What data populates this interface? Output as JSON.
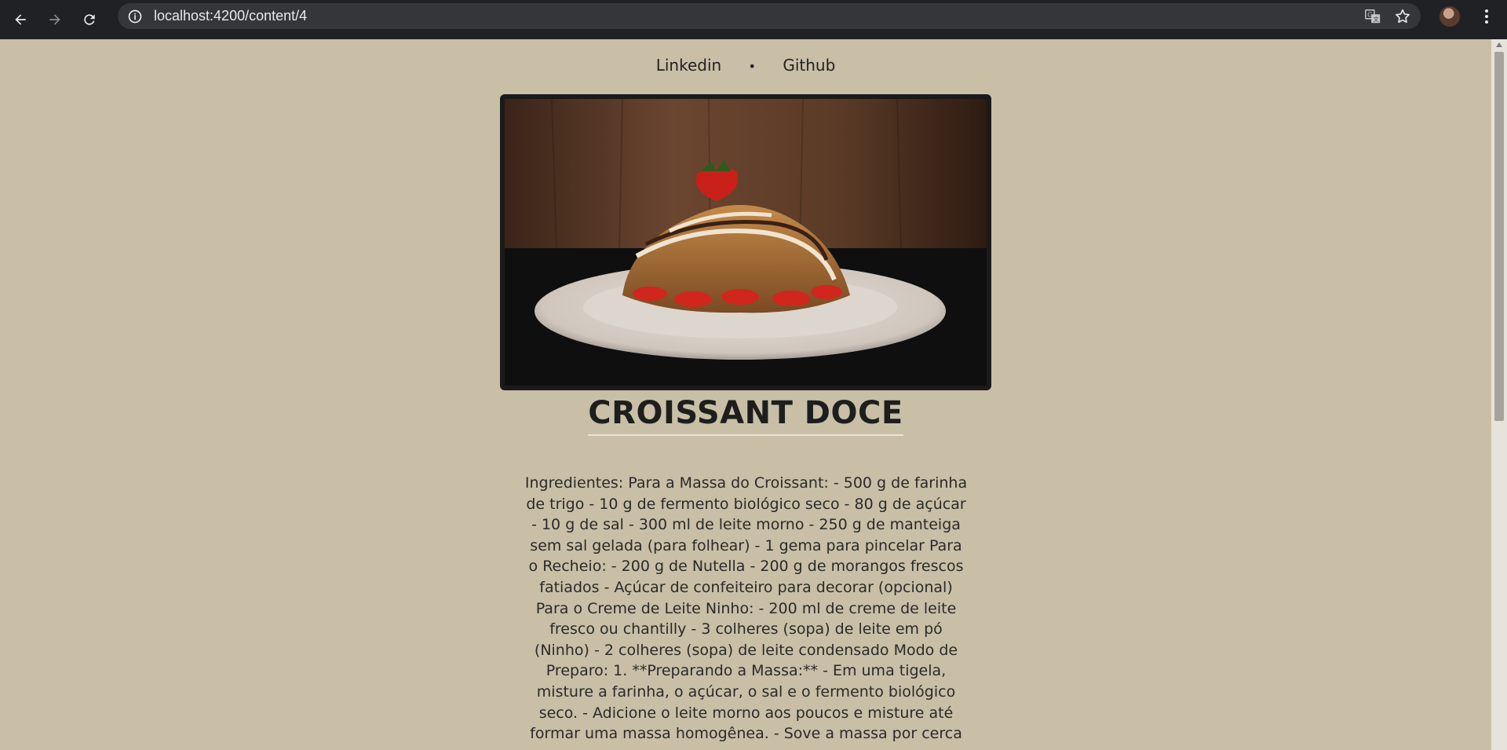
{
  "browser": {
    "url": "localhost:4200/content/4"
  },
  "nav": {
    "links": [
      "Linkedin",
      "Github"
    ],
    "separator": "•"
  },
  "content": {
    "title": "CROISSANT DOCE",
    "body": "Ingredientes: Para a Massa do Croissant: - 500 g de farinha de trigo - 10 g de fermento biológico seco - 80 g de açúcar - 10 g de sal - 300 ml de leite morno - 250 g de manteiga sem sal gelada (para folhear) - 1 gema para pincelar Para o Recheio: - 200 g de Nutella - 200 g de morangos frescos fatiados - Açúcar de confeiteiro para decorar (opcional) Para o Creme de Leite Ninho: - 200 ml de creme de leite fresco ou chantilly - 3 colheres (sopa) de leite em pó (Ninho) - 2 colheres (sopa) de leite condensado Modo de Preparo: 1. **Preparando a Massa:** - Em uma tigela, misture a farinha, o açúcar, o sal e o fermento biológico seco. - Adicione o leite morno aos poucos e misture até formar uma massa homogênea. - Sove a massa por cerca"
  },
  "icons": {
    "back": "arrow-left-icon",
    "forward": "arrow-right-icon",
    "reload": "reload-icon",
    "site_info": "info-icon",
    "translate": "translate-icon",
    "bookmark": "star-icon",
    "menu": "kebab-menu-icon"
  },
  "colors": {
    "page_background": "#c8bfa6",
    "chrome_background": "#202124",
    "text": "#222222"
  }
}
